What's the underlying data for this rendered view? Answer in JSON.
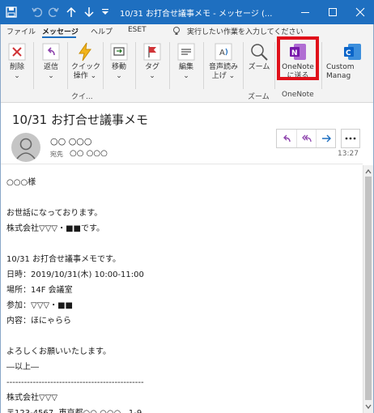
{
  "window": {
    "title": "10/31 お打合せ議事メモ - メッセージ (...",
    "quick_access": [
      "save-icon",
      "undo-icon",
      "redo-icon",
      "arrow-up-icon",
      "arrow-down-icon",
      "customize-icon"
    ],
    "controls": [
      "minimize-icon",
      "maximize-icon",
      "close-icon"
    ],
    "accent_color": "#1e6fc0"
  },
  "menu": {
    "items": [
      "ファイル",
      "メッセージ",
      "ヘルプ",
      "ESET"
    ],
    "active": "メッセージ",
    "tellme_placeholder": "実行したい作業を入力してください"
  },
  "ribbon": {
    "buttons": {
      "delete": "削除",
      "reply": "返信",
      "quick_l1": "クイック",
      "quick_l2": "操作",
      "move": "移動",
      "tag": "タグ",
      "edit": "編集",
      "read_l1": "音声読み",
      "read_l2": "上げ",
      "zoom": "ズーム",
      "onenote_l1": "OneNote",
      "onenote_l2": "に送る",
      "custom_l1": "Custom",
      "custom_l2": "Manag"
    },
    "groups": {
      "quick": "クイ...",
      "zoom": "ズーム",
      "onenote": "OneNote"
    },
    "highlight_color": "#e0101a"
  },
  "message": {
    "subject": "10/31 お打合せ議事メモ",
    "sender": "○○ ○○○",
    "to_label": "宛先",
    "to_value": "○○ ○○○",
    "time": "13:27",
    "body_lines": [
      "○○○様",
      "",
      "お世話になっております。",
      "株式会社▽▽▽・■■です。",
      "",
      "10/31 お打合せ議事メモです。",
      "日時：2019/10/31(木) 10:00-11:00",
      "場所：14F 会議室",
      "参加：▽▽▽・■■",
      "内容：ほにゃらら",
      "",
      "よろしくお願いいたします。",
      "―以上―",
      "-----------------------------------------------",
      "株式会社▽▽▽",
      "〒123-4567  東京都○○ ○○○   1-9"
    ]
  }
}
